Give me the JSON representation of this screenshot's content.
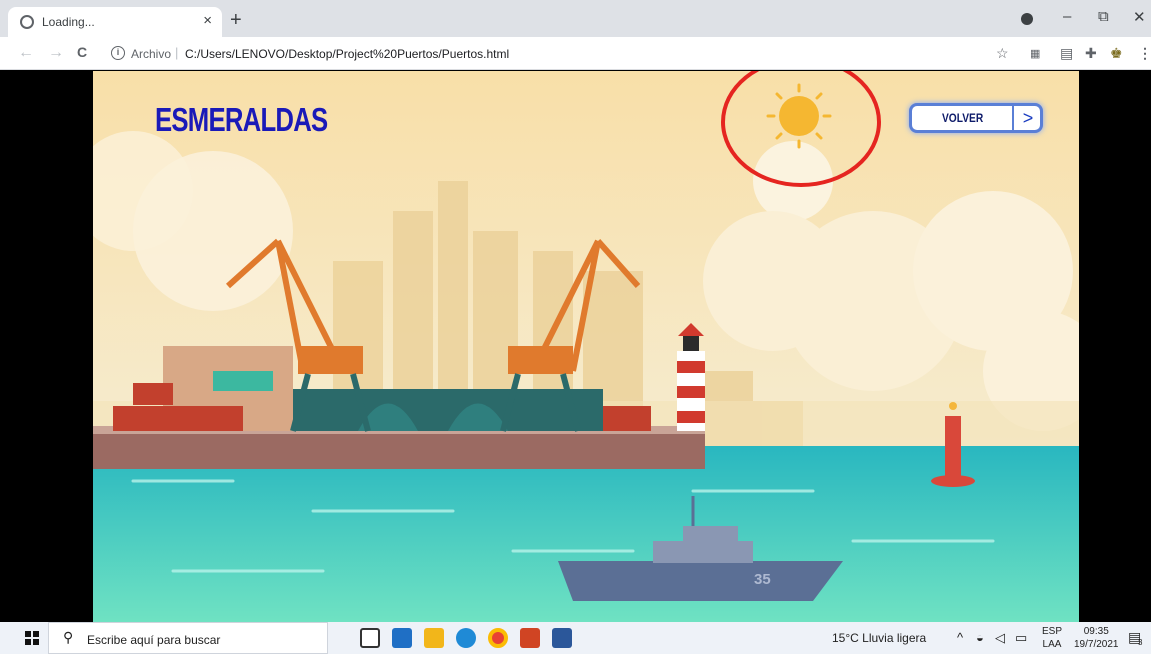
{
  "browser": {
    "tab_title": "Loading...",
    "tab_close": "×",
    "new_tab": "+",
    "url_scheme": "Archivo",
    "url_separator": "|",
    "url": "C:/Users/LENOVO/Desktop/Project%20Puertos/Puertos.html",
    "window_controls": {
      "minimize": "–",
      "restore": "⧉",
      "close": "✕"
    },
    "nav": {
      "back": "←",
      "forward": "→",
      "reload": "C"
    },
    "toolbar_icons": [
      "star-icon",
      "extension-icon",
      "reading-list-icon",
      "puzzle-icon",
      "profile-icon",
      "menu-icon"
    ]
  },
  "page": {
    "title": "ESMERALDAS",
    "back_button_label": "VOLVER",
    "back_button_arrow": ">",
    "weather_icon": "sun-icon",
    "ship_number": "35",
    "colors": {
      "title": "#1a1ab8",
      "sky": "#f7e3b5",
      "sea": "#3cc9c6",
      "highlight_ring": "#e52520"
    }
  },
  "taskbar": {
    "search_placeholder": "Escribe aquí para buscar",
    "weather": "15°C  Lluvia ligera",
    "lang_top": "ESP",
    "lang_bottom": "LAA",
    "time": "09:35",
    "date": "19/7/2021",
    "notification_count": "3"
  }
}
